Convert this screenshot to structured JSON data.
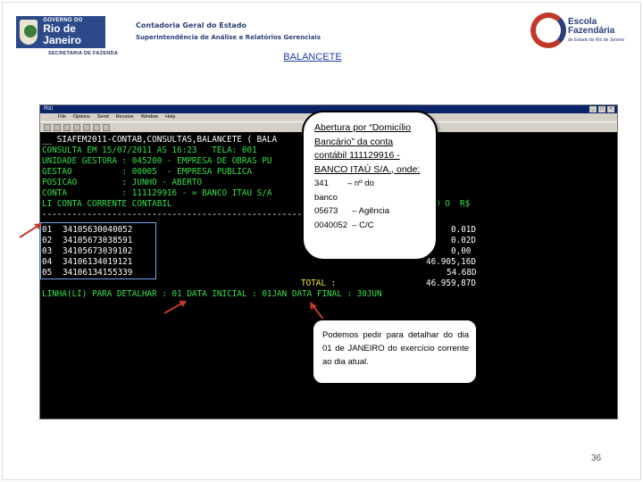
{
  "header": {
    "gov_small": "GOVERNO DO",
    "gov_big": "Rio de Janeiro",
    "secretaria": "SECRETARIA DE FAZENDA",
    "org_line1": "Contadoria Geral do Estado",
    "org_line2": "Superintendência de Análise e Relatórios Gerenciais",
    "escola_line1": "Escola",
    "escola_line2": "Fazendária",
    "escola_sub": "do Estado do Rio de Janeiro"
  },
  "slide_title": "BALANCETE",
  "terminal": {
    "window_title": "Rizi",
    "menu": [
      "File",
      "Options",
      "Send",
      "Receive",
      "Window",
      "Help"
    ],
    "lines": {
      "l1": "__ SIAFEM2011-CONTAB,CONSULTAS,BALANCETE ( BALA",
      "l2": "CONSULTA EM 15/07/2011 AS 16:23   TELA: 001",
      "l3": "UNIDADE GESTORA : 045200 - EMPRESA DE OBRAS PU",
      "l4": "GESTAO          : 00005  - EMPRESA PUBLICA",
      "l5": "POSICAO         : JUNHO - ABERTO",
      "l6": "CONTA           : 111129916 - = BANCO ITAU S/A",
      "l7": "LI CONTA CORRENTE CONTABIL",
      "l7_right": "D O  R$",
      "l8": "--------------------------------------------------------------------------",
      "rows": [
        {
          "id": "01",
          "num": "34105630040052",
          "value": "0.01D"
        },
        {
          "id": "02",
          "num": "34105673038591",
          "value": "0.02D"
        },
        {
          "id": "03",
          "num": "34105673039102",
          "value": "0,00"
        },
        {
          "id": "04",
          "num": "34106134019121",
          "value": "46.905,16D"
        },
        {
          "id": "05",
          "num": "34106134155339",
          "value": "54.68D"
        }
      ],
      "total_label": "TOTAL :",
      "total_value": "46.959,87D",
      "footer": "LINHA(LI) PARA DETALHAR : 01 DATA INICIAL : 01JAN DATA FINAL : 30JUN"
    }
  },
  "callout1": {
    "title": "Abertura por “Domicílio Bancário” da conta contábil 111129916 - BANCO ITAÚ S/A., onde:",
    "body": "341        – nº do\nbanco\n05673      – Agência\n0040052  – C/C"
  },
  "callout2": {
    "text": "Podemos pedir para detalhar do dia 01 de JANEIRO do exercício corrente ao dia atual."
  },
  "page_number": "36",
  "colors": {
    "title_link": "#1f3fa0",
    "terminal_bg": "#000000",
    "terminal_green": "#34e04a",
    "terminal_yellow": "#f2e341",
    "arrow": "#c0392b"
  }
}
